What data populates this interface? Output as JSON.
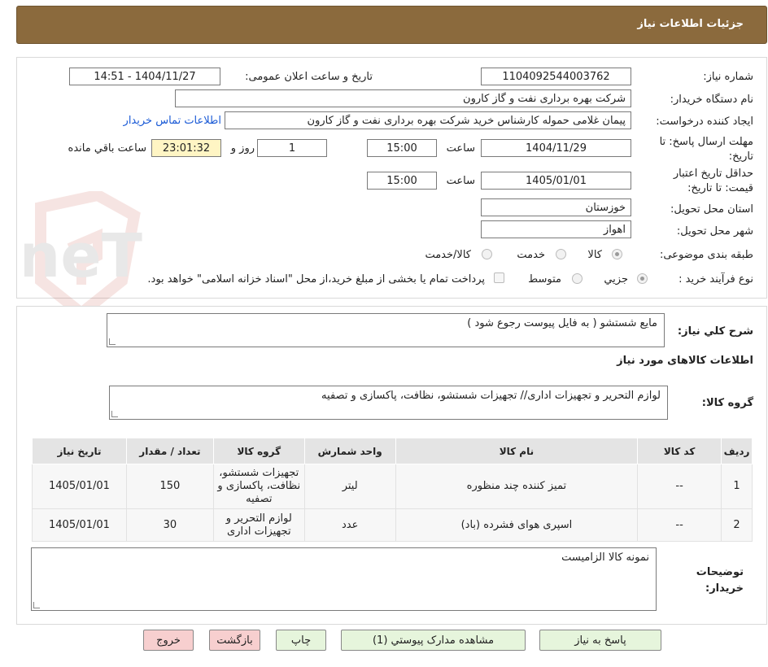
{
  "header": {
    "title": "جزئیات اطلاعات نیاز"
  },
  "form": {
    "need_number_label": "شماره نیاز:",
    "need_number": "1104092544003762",
    "announce_label": "تاریخ و ساعت اعلان عمومی:",
    "announce_value": "1404/11/27 - 14:51",
    "buyer_org_label": "نام دستگاه خریدار:",
    "buyer_org": "شرکت بهره برداری نفت و گاز کارون",
    "requester_label": "ایجاد کننده درخواست:",
    "requester": "پیمان غلامی حموله کارشناس خرید شرکت بهره برداری نفت و گاز کارون",
    "buyer_contact_link": "اطلاعات تماس خریدار",
    "deadline_label": "مهلت ارسال پاسخ: تا تاریخ:",
    "deadline_date": "1404/11/29",
    "time_label": "ساعت",
    "deadline_time": "15:00",
    "days_value": "1",
    "days_label": "روز و",
    "remaining_time": "23:01:32",
    "remaining_label": "ساعت باقي مانده",
    "validity_label": "حداقل تاریخ اعتبار قیمت: تا تاریخ:",
    "validity_date": "1405/01/01",
    "validity_time": "15:00",
    "province_label": "استان محل تحویل:",
    "province": "خوزستان",
    "city_label": "شهر محل تحویل:",
    "city": "اهواز",
    "category_label": "طبقه بندی موضوعی:",
    "category_options": [
      "کالا",
      "خدمت",
      "کالا/خدمت"
    ],
    "purchase_type_label": "نوع فرآیند خرید :",
    "purchase_options": [
      "جزیي",
      "متوسط"
    ],
    "payment_note": "پرداخت تمام یا بخشی از مبلغ خرید،از محل \"اسناد خزانه اسلامی\" خواهد بود."
  },
  "summary": {
    "label": "شرح کلي نياز:",
    "value": "مایع شستشو ( به فایل پیوست رجوع شود )",
    "goods_info_title": "اطلاعات کالاهای مورد نياز",
    "group_label": "گروه کالا:",
    "group_value": "لوازم التحریر و تجهیزات اداری// تجهیزات شستشو، نظافت، پاکسازی و تصفیه"
  },
  "table": {
    "headers": [
      "ردیف",
      "کد کالا",
      "نام کالا",
      "واحد شمارش",
      "گروه کالا",
      "تعداد / مقدار",
      "تاریخ نیاز"
    ],
    "rows": [
      {
        "row": "1",
        "code": "--",
        "name": "تمیز کننده چند منظوره",
        "unit": "لیتر",
        "group": "تجهیزات شستشو، نظافت، پاکسازی و تصفیه",
        "qty": "150",
        "date": "1405/01/01"
      },
      {
        "row": "2",
        "code": "--",
        "name": "اسپری هوای فشرده (باد)",
        "unit": "عدد",
        "group": "لوازم التحریر و تجهیزات اداری",
        "qty": "30",
        "date": "1405/01/01"
      }
    ]
  },
  "notes": {
    "label": "توضیحات خریدار:",
    "value": "نمونه کالا الزامیست"
  },
  "buttons": {
    "reply": "پاسخ به نیاز",
    "attachments": "مشاهده مدارک پیوستي (1)",
    "print": "چاپ",
    "back": "بازگشت",
    "exit": "خروج"
  },
  "watermark": {
    "text": "AriaTender.neT"
  },
  "colors": {
    "header": "#8B6A3D",
    "link": "#1a5ad6",
    "green_button": "#E6F5DC",
    "pink_button": "#F7CFCF",
    "remaining_bg": "#FFF5C4"
  }
}
